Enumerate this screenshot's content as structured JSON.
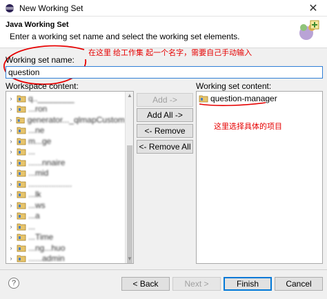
{
  "window": {
    "title": "New Working Set",
    "close_glyph": "✕"
  },
  "banner": {
    "heading": "Java Working Set",
    "description": "Enter a working set name and select the working set elements."
  },
  "form": {
    "name_label": "Working set name:",
    "name_value": "question",
    "workspace_label": "Workspace content:",
    "content_label": "Working set content:"
  },
  "annotations": {
    "name_note": "在这里  给工作集  起一个名字，需要自己手动输入",
    "select_note": "这里选择具体的项目"
  },
  "workspace_items": [
    "q..________",
    "...ron",
    "generator..._qlmapCustom",
    "...ne",
    "m...ge",
    "...",
    "......nnaire",
    "...mid",
    "...................",
    "...lk",
    "...ws",
    "...a",
    "...",
    "...Time",
    "...ng...huo",
    "......admin"
  ],
  "content_items": [
    "question-manager"
  ],
  "buttons": {
    "add": "Add ->",
    "add_all": "Add All ->",
    "remove": "<- Remove",
    "remove_all": "<- Remove All",
    "back": "< Back",
    "next": "Next >",
    "finish": "Finish",
    "cancel": "Cancel",
    "help": "?"
  },
  "colors": {
    "accent": "#0078d7",
    "annotation": "#e60000",
    "focus_border": "#2f7fd6"
  }
}
